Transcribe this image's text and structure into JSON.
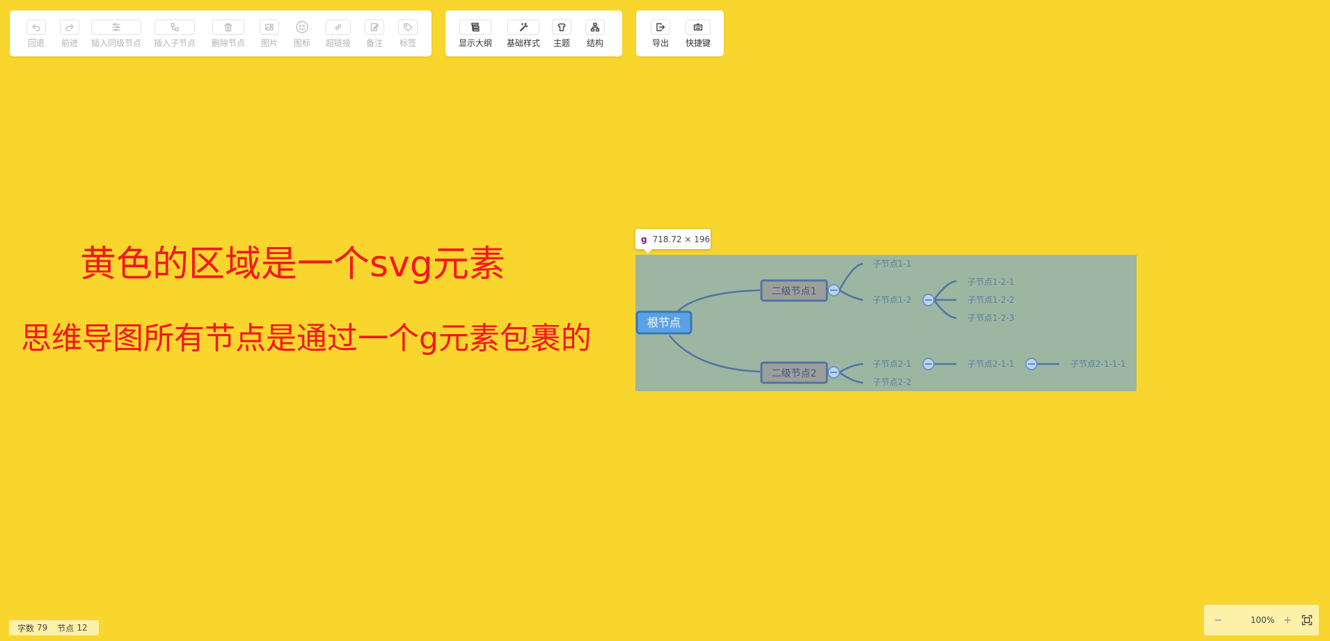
{
  "toolbar": {
    "edit_group": [
      {
        "name": "undo-button",
        "label": "回退",
        "icon": "undo-icon"
      },
      {
        "name": "redo-button",
        "label": "前进",
        "icon": "redo-icon"
      },
      {
        "name": "insert-sibling-button",
        "label": "插入同级节点",
        "icon": "sibling-node-icon"
      },
      {
        "name": "insert-child-button",
        "label": "插入子节点",
        "icon": "child-node-icon"
      },
      {
        "name": "delete-node-button",
        "label": "删除节点",
        "icon": "trash-icon"
      },
      {
        "name": "image-button",
        "label": "图片",
        "icon": "image-icon"
      },
      {
        "name": "icon-button",
        "label": "图标",
        "icon": "smiley-icon"
      },
      {
        "name": "hyperlink-button",
        "label": "超链接",
        "icon": "link-icon"
      },
      {
        "name": "note-button",
        "label": "备注",
        "icon": "note-icon"
      },
      {
        "name": "tag-button",
        "label": "标签",
        "icon": "tag-icon"
      }
    ],
    "view_group": [
      {
        "name": "show-outline-button",
        "label": "显示大纲",
        "icon": "outline-icon"
      },
      {
        "name": "base-style-button",
        "label": "基础样式",
        "icon": "magic-wand-icon"
      },
      {
        "name": "theme-button",
        "label": "主题",
        "icon": "shirt-icon"
      },
      {
        "name": "structure-button",
        "label": "结构",
        "icon": "structure-icon"
      }
    ],
    "file_group": [
      {
        "name": "export-button",
        "label": "导出",
        "icon": "export-icon"
      },
      {
        "name": "shortcut-button",
        "label": "快捷键",
        "icon": "keyboard-icon"
      }
    ]
  },
  "annotations": {
    "line1": "黄色的区域是一个svg元素",
    "line2": "思维导图所有节点是通过一个g元素包裹的"
  },
  "devtools_tooltip": {
    "tag": "g",
    "size": "718.72 × 196"
  },
  "mindmap": {
    "root": "根节点",
    "branches": [
      {
        "label": "二级节点1",
        "children": [
          {
            "label": "子节点1-1",
            "children": []
          },
          {
            "label": "子节点1-2",
            "children": [
              {
                "label": "子节点1-2-1"
              },
              {
                "label": "子节点1-2-2"
              },
              {
                "label": "子节点1-2-3"
              }
            ]
          }
        ]
      },
      {
        "label": "二级节点2",
        "children": [
          {
            "label": "子节点2-1",
            "children": [
              {
                "label": "子节点2-1-1",
                "children": [
                  {
                    "label": "子节点2-1-1-1"
                  }
                ]
              }
            ]
          },
          {
            "label": "子节点2-2",
            "children": []
          }
        ]
      }
    ]
  },
  "status": {
    "word_count_label": "字数",
    "word_count": "79",
    "node_count_label": "节点",
    "node_count": "12"
  },
  "zoom": {
    "zoom_out_icon": "minus-icon",
    "level": "100%",
    "zoom_in_icon": "plus-icon",
    "fit_icon": "fullscreen-icon"
  },
  "colors": {
    "canvas_bg": "#f8d62e",
    "annotation_text": "#f4171d",
    "mindmap_bg": "#9db6a1",
    "root_fill": "#5aa1e6",
    "branch_line": "#4f73a3"
  }
}
